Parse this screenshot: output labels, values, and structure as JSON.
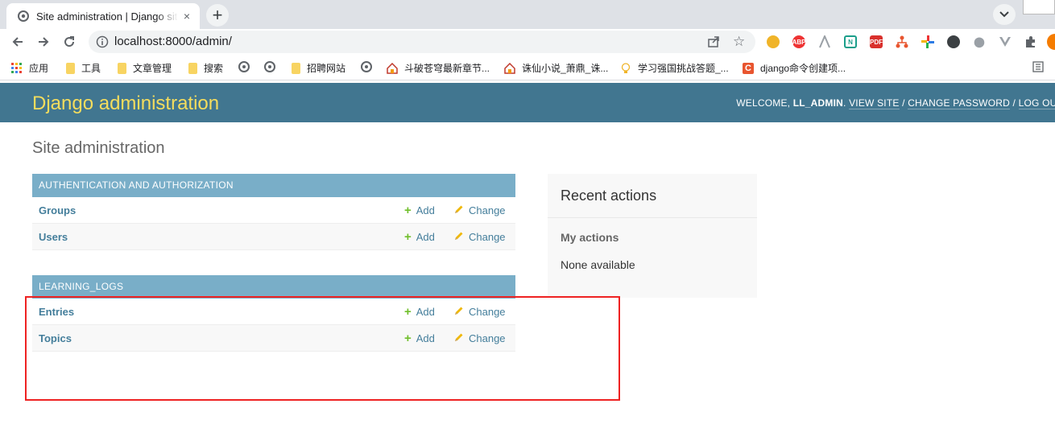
{
  "browser": {
    "tab_title": "Site administration | Django site admin",
    "tab_close": "×",
    "new_tab": "+",
    "url": "localhost:8000/admin/",
    "star": "☆",
    "bookmarks": [
      {
        "icon": "apps-grid-icon",
        "label": "应用"
      },
      {
        "icon": "folder-icon",
        "label": "工具"
      },
      {
        "icon": "folder-icon",
        "label": "文章管理"
      },
      {
        "icon": "folder-icon",
        "label": "搜索"
      },
      {
        "icon": "globe-icon",
        "label": ""
      },
      {
        "icon": "globe-icon",
        "label": ""
      },
      {
        "icon": "folder-icon",
        "label": "招聘网站"
      },
      {
        "icon": "globe-icon",
        "label": ""
      },
      {
        "icon": "house-icon",
        "label": "斗破苍穹最新章节..."
      },
      {
        "icon": "house-icon",
        "label": "诛仙小说_萧鼎_诛..."
      },
      {
        "icon": "lightbulb-icon",
        "label": "学习强国挑战答题_..."
      },
      {
        "icon": "c-logo-icon",
        "label": "django命令创建项..."
      }
    ],
    "extensions": {
      "abp": "ABP",
      "pdf": "PDF"
    }
  },
  "admin": {
    "branding": "Django administration",
    "usertools": {
      "welcome": "WELCOME, ",
      "username": "LL_ADMIN",
      "sep1": ". ",
      "view_site": "VIEW SITE",
      "sep2": " / ",
      "change_password": "CHANGE PASSWORD",
      "sep3": " / ",
      "log_out": "LOG OUT"
    },
    "page_title": "Site administration",
    "apps": [
      {
        "caption": "AUTHENTICATION AND AUTHORIZATION",
        "models": [
          {
            "name": "Groups",
            "add": "Add",
            "change": "Change"
          },
          {
            "name": "Users",
            "add": "Add",
            "change": "Change"
          }
        ]
      },
      {
        "caption": "LEARNING_LOGS",
        "models": [
          {
            "name": "Entries",
            "add": "Add",
            "change": "Change"
          },
          {
            "name": "Topics",
            "add": "Add",
            "change": "Change"
          }
        ]
      }
    ],
    "recent_actions": {
      "title": "Recent actions",
      "my_actions": "My actions",
      "none": "None available"
    }
  },
  "colors": {
    "header_bg": "#417690",
    "branding": "#f5dd5d",
    "module_caption": "#79aec8",
    "link": "#447e9b",
    "add_icon": "#70bf2b",
    "highlight_box": "#e22222"
  }
}
